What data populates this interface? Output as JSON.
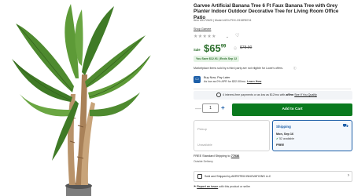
{
  "product": {
    "title": "Garvee Artificial Banana Tree 6 Ft Faux Banana Tree with Grey Planter Indoor Outdoor Decorative Tree for Living Room Office Patio",
    "item_number": "Item #5172625 | Model #ZCLPHX-3315R8741",
    "brand_link": "Shop Garvee",
    "stars": "★★★★★",
    "rating_chevron": "⌄",
    "favorite_icon": "heart-icon"
  },
  "pricing": {
    "sale_label": "Sale",
    "price": "$65",
    "price_cents": "99",
    "was_price": "$78.90",
    "save_text": "You Save $12.91 | Ends Sep 12"
  },
  "marketplace": {
    "notice": "Marketplace items sold by a third party are not eligible for Lowe's offers.",
    "info_icon": "ⓘ"
  },
  "bnpl": {
    "line1": "Buy Now, Pay Later",
    "line2": "As low as 0% APR for $32.00/mo.",
    "learn": "Learn How"
  },
  "affirm": {
    "text": "4 interest-free payments or as low as $12/mo with",
    "logo": "affirm",
    "link": "See If You Qualify"
  },
  "cart": {
    "quantity": "1",
    "minus": "—",
    "plus": "+",
    "add_label": "Add to Cart"
  },
  "pickup": {
    "title": "Pickup",
    "subtitle": "Unavailable"
  },
  "shipping": {
    "title": "Shipping",
    "date": "Mon, Sep 16",
    "available": "52 available",
    "cost": "FREE"
  },
  "delivery": {
    "free_standard_prefix": "FREE Standard Shipping to",
    "zip": "77036",
    "outside": "Outside Delivery"
  },
  "seller": {
    "text": "Sold and Shipped by ADRSTEM INNOVATIONS LLC"
  },
  "report": {
    "link": "Report an issue",
    "suffix": "with this product or seller"
  }
}
